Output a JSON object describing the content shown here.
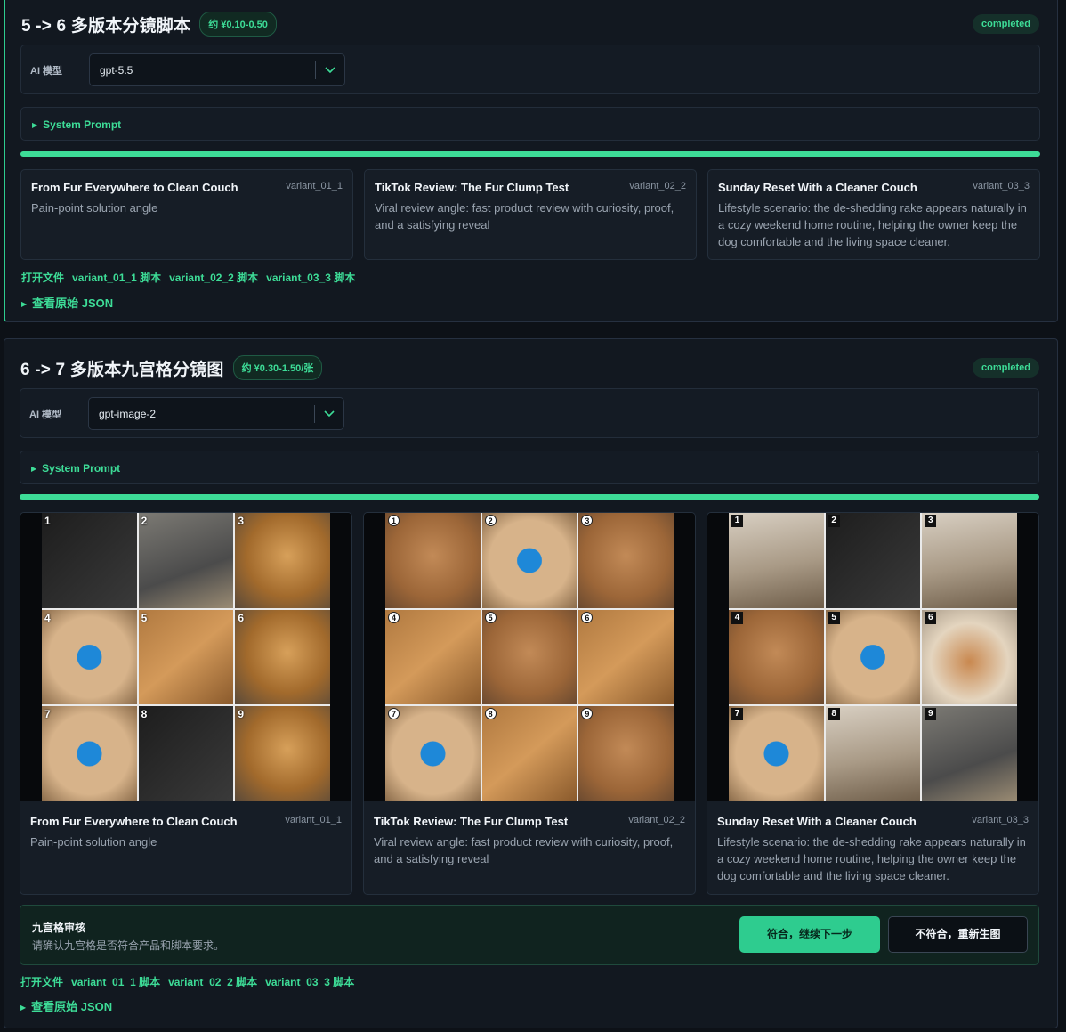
{
  "stage1": {
    "title": "5 -> 6 多版本分镜脚本",
    "cost": "约 ¥0.10-0.50",
    "status": "completed",
    "model_label": "AI 模型",
    "model_value": "gpt-5.5",
    "system_prompt_label": "System Prompt",
    "progress_percent": 100,
    "variants": [
      {
        "title": "From Fur Everywhere to Clean Couch",
        "id": "variant_01_1",
        "desc": "Pain-point solution angle"
      },
      {
        "title": "TikTok Review: The Fur Clump Test",
        "id": "variant_02_2",
        "desc": "Viral review angle: fast product review with curiosity, proof, and a satisfying reveal"
      },
      {
        "title": "Sunday Reset With a Cleaner Couch",
        "id": "variant_03_3",
        "desc": "Lifestyle scenario: the de-shedding rake appears naturally in a cozy weekend home routine, helping the owner keep the dog comfortable and the living space cleaner."
      }
    ],
    "links": [
      "打开文件",
      "variant_01_1 脚本",
      "variant_02_2 脚本",
      "variant_03_3 脚本"
    ],
    "json_toggle": "查看原始 JSON"
  },
  "stage2": {
    "title": "6 -> 7 多版本九宫格分镜图",
    "cost": "约 ¥0.30-1.50/张",
    "status": "completed",
    "model_label": "AI 模型",
    "model_value": "gpt-image-2",
    "system_prompt_label": "System Prompt",
    "progress_percent": 100,
    "grid_numbers": [
      "1",
      "2",
      "3",
      "4",
      "5",
      "6",
      "7",
      "8",
      "9"
    ],
    "variants": [
      {
        "title": "From Fur Everywhere to Clean Couch",
        "id": "variant_01_1",
        "desc": "Pain-point solution angle"
      },
      {
        "title": "TikTok Review: The Fur Clump Test",
        "id": "variant_02_2",
        "desc": "Viral review angle: fast product review with curiosity, proof, and a satisfying reveal"
      },
      {
        "title": "Sunday Reset With a Cleaner Couch",
        "id": "variant_03_3",
        "desc": "Lifestyle scenario: the de-shedding rake appears naturally in a cozy weekend home routine, helping the owner keep the dog comfortable and the living space cleaner."
      }
    ],
    "review": {
      "title": "九宫格审核",
      "desc": "请确认九宫格是否符合产品和脚本要求。",
      "approve_label": "符合，继续下一步",
      "reject_label": "不符合，重新生图"
    },
    "links": [
      "打开文件",
      "variant_01_1 脚本",
      "variant_02_2 脚本",
      "variant_03_3 脚本"
    ],
    "json_toggle": "查看原始 JSON"
  },
  "colors": {
    "accent": "#3ddc97",
    "background": "#0d1117",
    "panel": "#121820"
  },
  "icons": {
    "chevron": "chevron-down-icon",
    "expand": "triangle-right-icon"
  }
}
